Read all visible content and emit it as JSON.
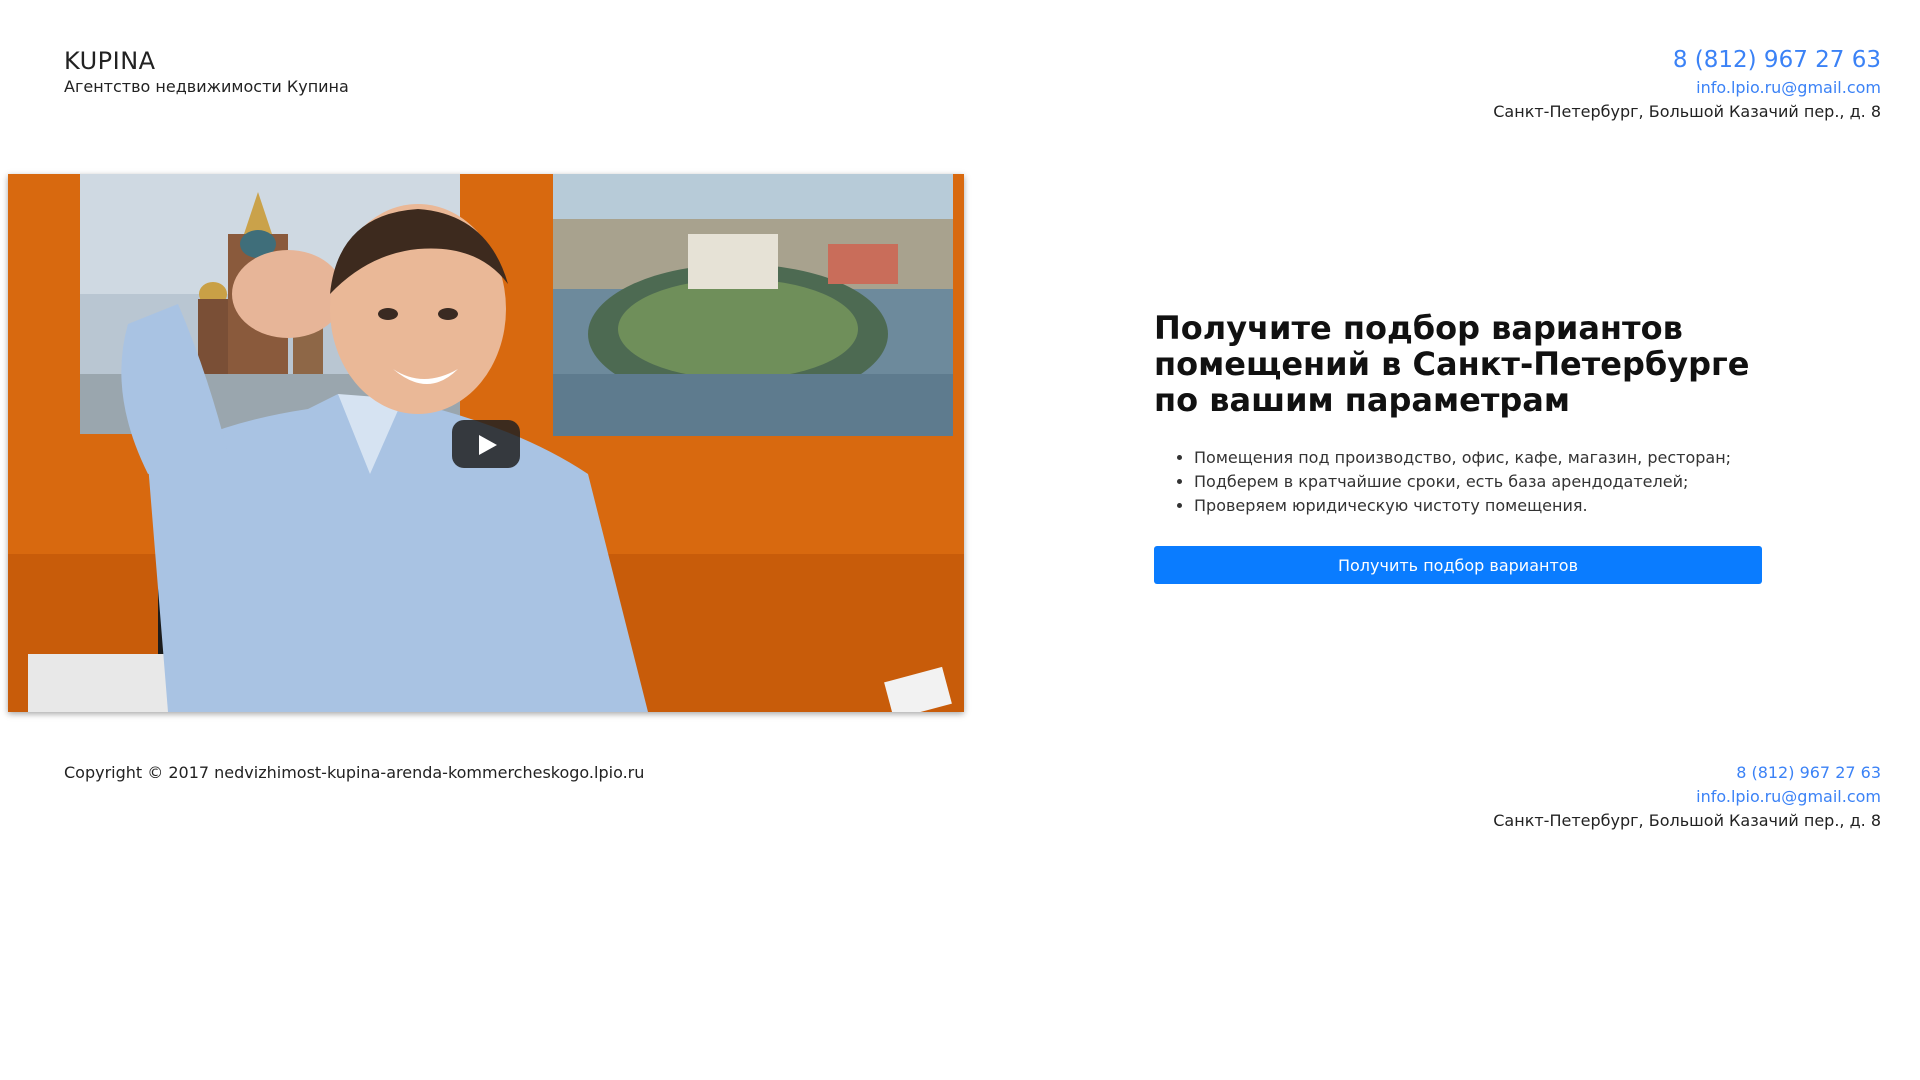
{
  "header": {
    "brand_name": "KUPINA",
    "brand_subtitle": "Агентство недвижимости Купина",
    "phone": "8 (812) 967 27 63",
    "email": "info.lpio.ru@gmail.com",
    "address": "Санкт-Петербург, Большой Казачий пер., д. 8"
  },
  "video": {
    "play_icon": "play-icon"
  },
  "offer": {
    "title": "Получите подбор вариантов помещений в Санкт-Петербурге по вашим параметрам",
    "bullets": [
      "Помещения под производство, офис, кафе, магазин, ресторан;",
      "Подберем в кратчайшие сроки, есть база арендодателей;",
      "Проверяем юридическую чистоту помещения."
    ],
    "cta_label": "Получить подбор вариантов"
  },
  "footer": {
    "copyright": "Copyright © 2017 nedvizhimost-kupina-arenda-kommercheskogo.lpio.ru",
    "phone": "8 (812) 967 27 63",
    "email": "info.lpio.ru@gmail.com",
    "address": "Санкт-Петербург, Большой Казачий пер., д. 8"
  },
  "colors": {
    "accent": "#0a7cff",
    "link": "#3b82f6",
    "video_wall": "#d46810"
  }
}
